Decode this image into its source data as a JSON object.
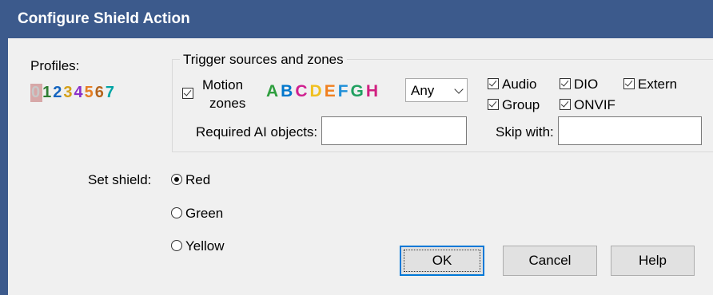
{
  "window": {
    "title": "Configure Shield Action"
  },
  "profiles": {
    "label": "Profiles:",
    "digits": [
      "0",
      "1",
      "2",
      "3",
      "4",
      "5",
      "6",
      "7"
    ]
  },
  "trigger": {
    "group_title": "Trigger sources and zones",
    "motion_line1": "Motion",
    "motion_line2": "zones",
    "zone_letters": [
      "A",
      "B",
      "C",
      "D",
      "E",
      "F",
      "G",
      "H"
    ],
    "zone_select": "Any",
    "audio": "Audio",
    "dio": "DIO",
    "extern": "Extern",
    "group": "Group",
    "onvif": "ONVIF",
    "required_ai_label": "Required AI objects:",
    "required_ai_value": "",
    "skip_label": "Skip with:",
    "skip_value": ""
  },
  "shield": {
    "label": "Set shield:",
    "options": [
      "Red",
      "Green",
      "Yellow"
    ],
    "selected": "Red"
  },
  "buttons": {
    "ok": "OK",
    "cancel": "Cancel",
    "help": "Help"
  },
  "colors": {
    "title_bar": "#3c5a8c",
    "digits": [
      "#c8c8c8",
      "#2e7d32",
      "#1565c0",
      "#d4a017",
      "#8b2fc9",
      "#e67e22",
      "#b5651d",
      "#00a4a4"
    ],
    "letters": [
      "#2e9e3e",
      "#0077cc",
      "#d02090",
      "#f0c020",
      "#f08020",
      "#1f8fd8",
      "#20a060",
      "#d02080"
    ]
  }
}
